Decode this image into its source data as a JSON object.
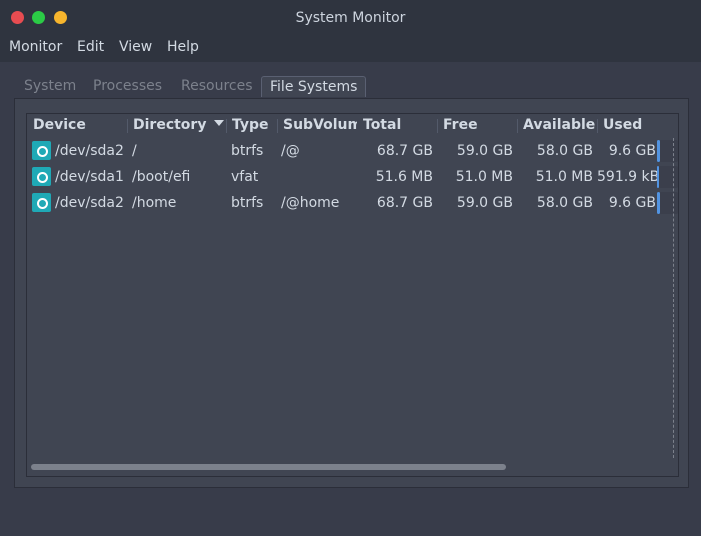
{
  "window": {
    "title": "System Monitor"
  },
  "menu": [
    "Monitor",
    "Edit",
    "View",
    "Help"
  ],
  "tabs": [
    "System",
    "Processes",
    "Resources",
    "File Systems"
  ],
  "active_tab": "File Systems",
  "columns": [
    "Device",
    "Directory",
    "Type",
    "SubVolume",
    "Total",
    "Free",
    "Available",
    "Used"
  ],
  "sort_column": "Directory",
  "rows": [
    {
      "device": "/dev/sda2",
      "directory": "/",
      "type": "btrfs",
      "subvolume": "/@",
      "total": "68.7 GB",
      "free": "59.0 GB",
      "available": "58.0 GB",
      "used": "9.6 GB",
      "used_fraction": 0.14
    },
    {
      "device": "/dev/sda1",
      "directory": "/boot/efi",
      "type": "vfat",
      "subvolume": "",
      "total": "51.6 MB",
      "free": "51.0 MB",
      "available": "51.0 MB",
      "used": "591.9 kB",
      "used_fraction": 0.01
    },
    {
      "device": "/dev/sda2",
      "directory": "/home",
      "type": "btrfs",
      "subvolume": "/@home",
      "total": "68.7 GB",
      "free": "59.0 GB",
      "available": "58.0 GB",
      "used": "9.6 GB",
      "used_fraction": 0.14
    }
  ],
  "colors": {
    "accent": "#5294e2",
    "drive_icon": "#1fa9b6",
    "close": "#e74c51",
    "maximize": "#2bcb46",
    "minimize": "#f7b52d"
  },
  "icons": {
    "device": "drive-harddisk-icon",
    "sort": "sort-descending-icon"
  }
}
